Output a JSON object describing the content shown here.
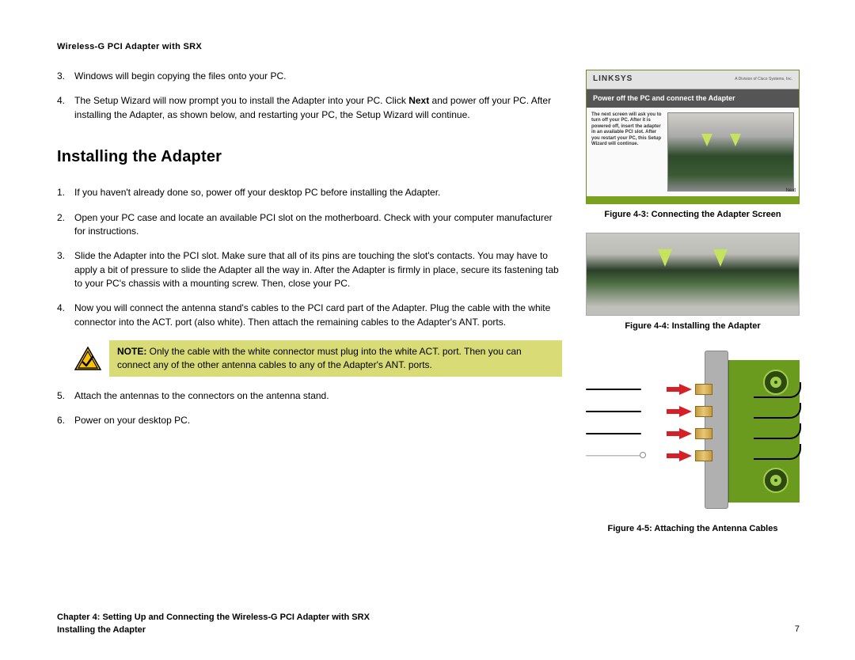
{
  "header": "Wireless-G PCI Adapter with SRX",
  "intro_steps": [
    {
      "n": "3.",
      "t": "Windows will begin copying the files onto your PC."
    },
    {
      "n": "4.",
      "t": "The Setup Wizard will now prompt you to install the Adapter into your PC. Click ",
      "bold": "Next",
      "t2": " and power off your PC. After installing the Adapter, as shown below, and restarting your PC, the Setup Wizard will continue."
    }
  ],
  "section_title": "Installing the Adapter",
  "install_steps": [
    {
      "n": "1.",
      "t": "If you haven't already done so, power off your desktop PC before installing the Adapter."
    },
    {
      "n": "2.",
      "t": "Open your PC case and locate an available PCI slot on the motherboard.  Check with your computer manufacturer for instructions."
    },
    {
      "n": "3.",
      "t": "Slide the Adapter into the PCI slot. Make sure that all of its pins are touching the slot's contacts. You may have to apply a bit of pressure to slide the Adapter all the way in. After the Adapter is firmly in place, secure its fastening tab to your PC's chassis with a mounting screw. Then, close your PC."
    },
    {
      "n": "4.",
      "t": "Now you will connect the antenna stand's cables to the PCI card part of the Adapter. Plug the cable with the white connector into the ACT. port (also white). Then attach the remaining cables to the Adapter's ANT. ports."
    }
  ],
  "note": {
    "label": "NOTE:",
    "text": "  Only the cable with the white connector must plug into the white ACT. port. Then you can connect any of the other antenna cables to any of the Adapter's ANT. ports."
  },
  "post_steps": [
    {
      "n": "5.",
      "t": "Attach the antennas to the connectors on the antenna stand."
    },
    {
      "n": "6.",
      "t": "Power on your desktop PC."
    }
  ],
  "wizard": {
    "brand": "LINKSYS",
    "brandsub": "A Division of Cisco Systems, Inc.",
    "title": "Power off the PC and connect the Adapter",
    "body": "The next screen will ask you to turn off your PC. After it is powered off, insert the adapter in an available PCI slot. After you restart your PC, this Setup Wizard will continue.",
    "next": "Next"
  },
  "captions": {
    "fig3": "Figure 4-3: Connecting the Adapter Screen",
    "fig4": "Figure 4-4: Installing the Adapter",
    "fig5": "Figure 4-5: Attaching the Antenna Cables"
  },
  "footer": {
    "chapter": "Chapter 4: Setting Up and Connecting the Wireless-G PCI Adapter with SRX",
    "section": "Installing the Adapter",
    "page": "7"
  }
}
